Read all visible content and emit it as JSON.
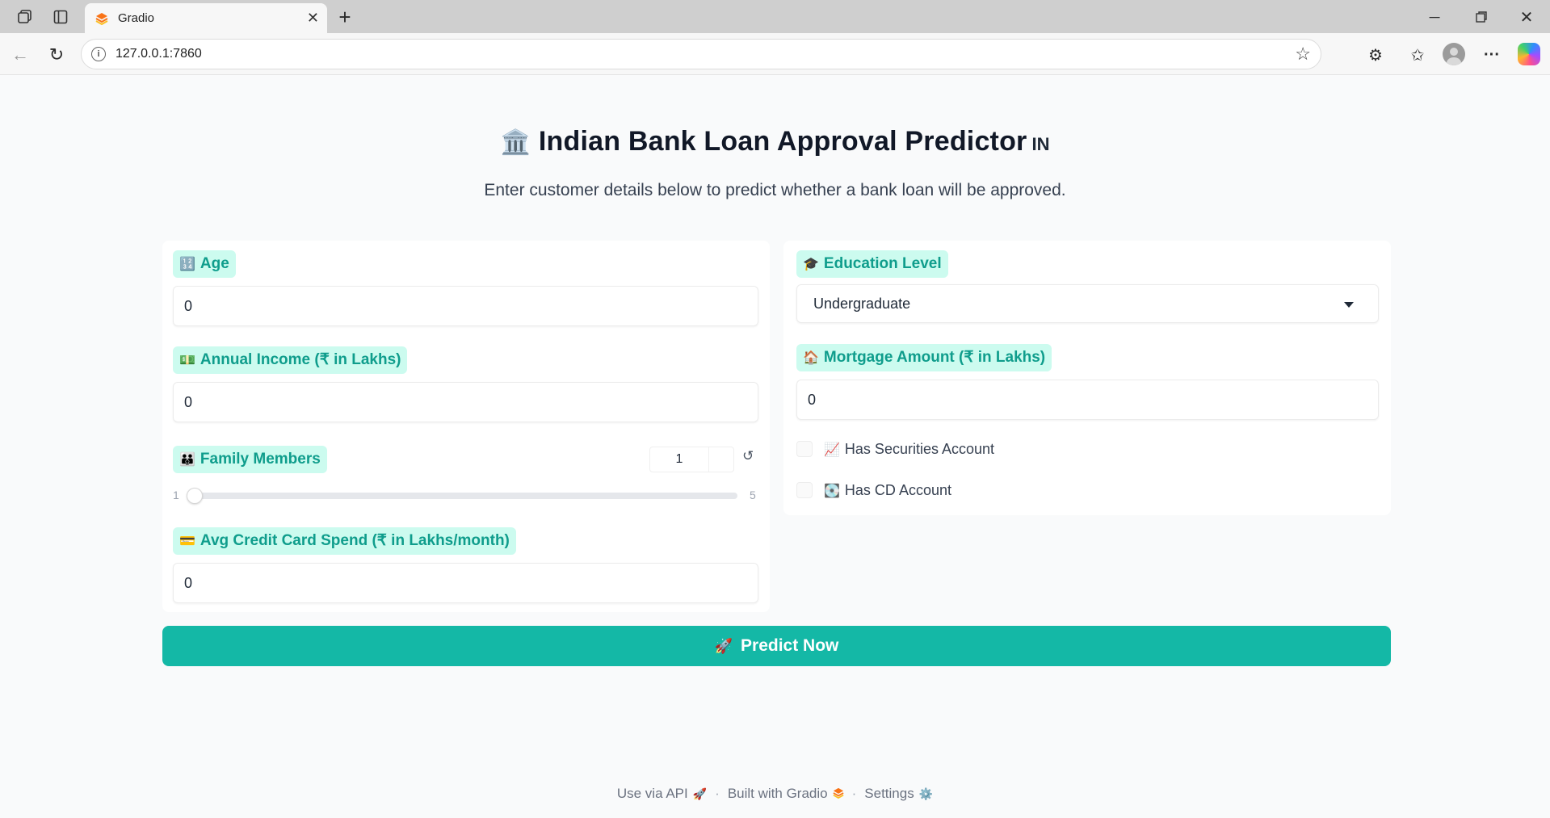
{
  "browser": {
    "tab_title": "Gradio",
    "url": "127.0.0.1:7860",
    "info_glyph": "i",
    "new_tab_glyph": "+",
    "close_glyph": "✕",
    "back_glyph": "←",
    "reload_glyph": "↻",
    "star_glyph": "☆",
    "extensions_glyph": "⚙",
    "favorites_glyph": "✩",
    "more_glyph": "···",
    "min_glyph": "─",
    "icons": [
      "workspaces-icon",
      "tab-actions-icon",
      "gradio-favicon",
      "info-icon",
      "star-icon",
      "extensions-icon",
      "favorites-icon",
      "profile-icon",
      "copilot-icon"
    ]
  },
  "header": {
    "title_emoji": "🏛️",
    "title": "Indian Bank Loan Approval Predictor",
    "title_flag": "IN",
    "subtitle": "Enter customer details below to predict whether a bank loan will be approved."
  },
  "form": {
    "age": {
      "emoji": "🔢",
      "label": "Age",
      "value": "0"
    },
    "income": {
      "emoji": "💵",
      "label": "Annual Income (₹ in Lakhs)",
      "value": "0"
    },
    "family": {
      "emoji": "👪",
      "label": "Family Members",
      "value": "1",
      "min": "1",
      "max": "5",
      "reset_glyph": "↺"
    },
    "ccavg": {
      "emoji": "💳",
      "label": "Avg Credit Card Spend (₹ in Lakhs/month)",
      "value": "0"
    },
    "education": {
      "emoji": "🎓",
      "label": "Education Level",
      "selected": "Undergraduate"
    },
    "mortgage": {
      "emoji": "🏠",
      "label": "Mortgage Amount (₹ in Lakhs)",
      "value": "0"
    },
    "securities": {
      "emoji": "📈",
      "label": "Has Securities Account",
      "checked": false
    },
    "cd": {
      "emoji": "💽",
      "label": "Has CD Account",
      "checked": false
    }
  },
  "action": {
    "emoji": "🚀",
    "label": "Predict Now"
  },
  "footer": {
    "api": "Use via API",
    "api_emoji": "🚀",
    "separator": "·",
    "built": "Built with Gradio",
    "built_emoji": "🟧",
    "settings": "Settings",
    "settings_emoji": "⚙️"
  },
  "colors": {
    "accent": "#14b8a6",
    "label_bg": "#ccfbef",
    "label_text": "#0f9d8c"
  }
}
